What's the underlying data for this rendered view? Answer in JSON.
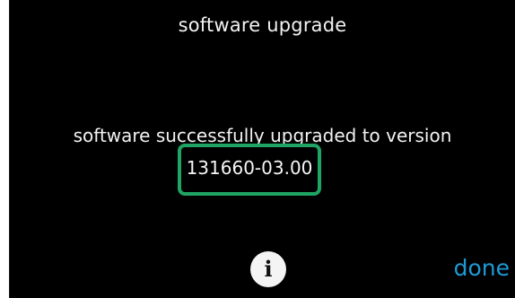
{
  "header": {
    "title": "software upgrade"
  },
  "main": {
    "message": "software successfully upgraded to version",
    "version": "131660-03.00"
  },
  "footer": {
    "info_label": "i",
    "done_label": "done"
  },
  "colors": {
    "background": "#000000",
    "text": "#f2f2f2",
    "highlight_border": "#1fa463",
    "done_accent": "#1d9ad6"
  },
  "icons": {
    "info": "info-icon"
  }
}
